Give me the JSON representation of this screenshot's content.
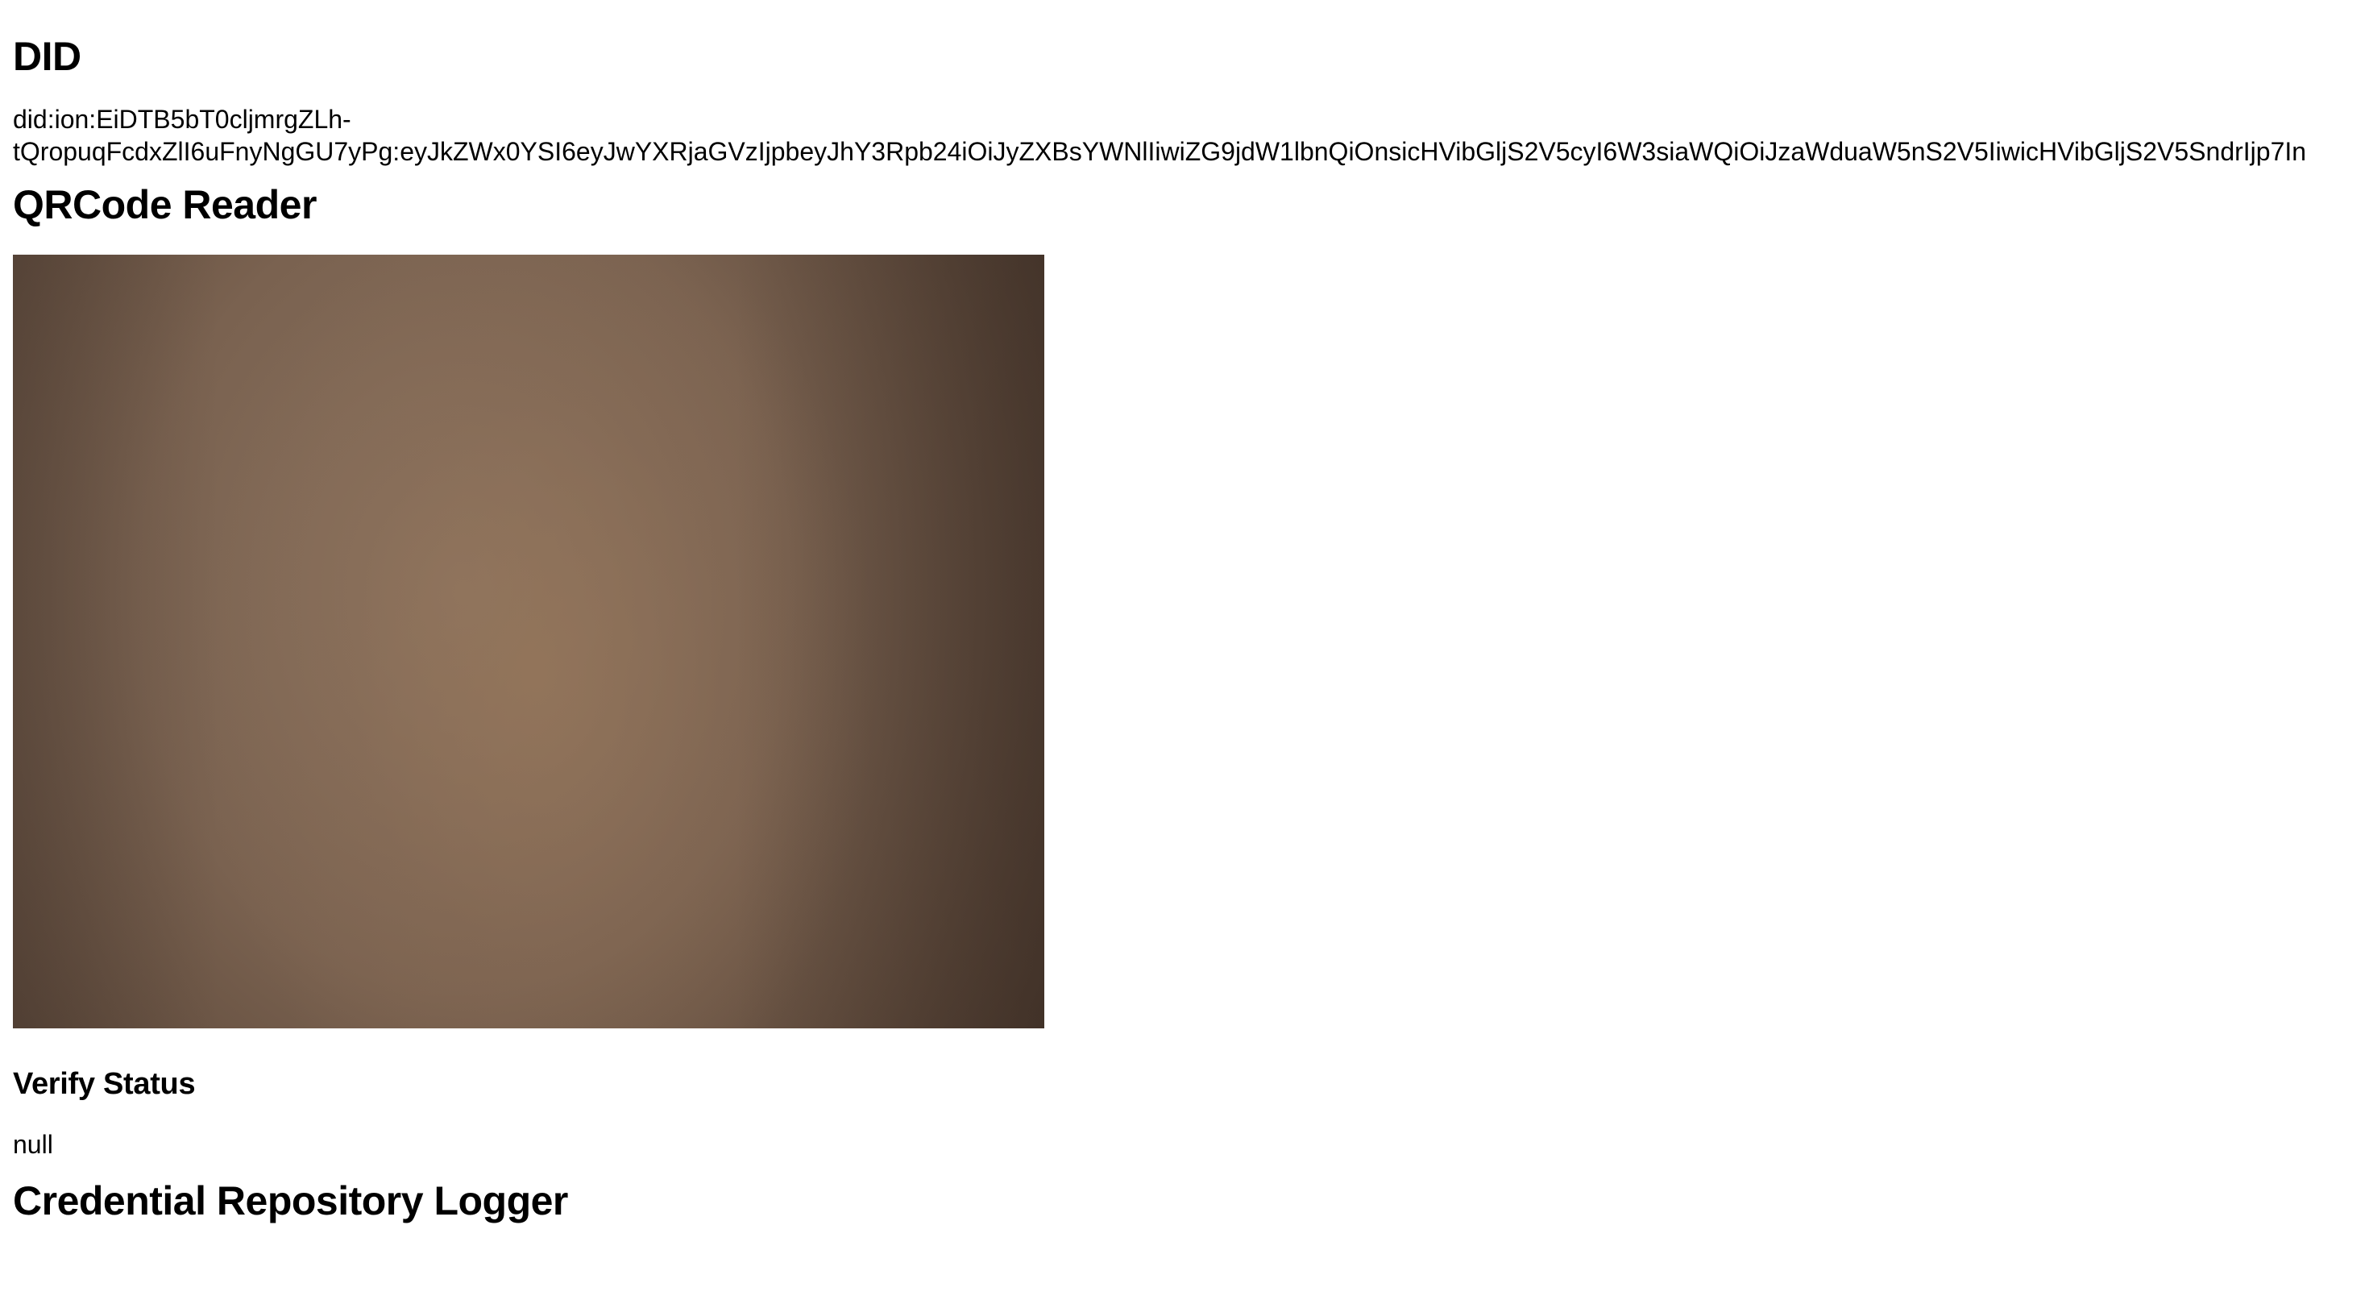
{
  "did_section": {
    "heading": "DID",
    "value_line1": "did:ion:EiDTB5bT0cljmrgZLh-",
    "value_line2": "tQropuqFcdxZlI6uFnyNgGU7yPg:eyJkZWx0YSI6eyJwYXRjaGVzIjpbeyJhY3Rpb24iOiJyZXBsYWNlIiwiZG9jdW1lbnQiOnsicHVibGljS2V5cyI6W3siaWQiOiJzaWduaW5nS2V5IiwicHVibGljS2V5SndrIjp7In"
  },
  "qr_section": {
    "heading": "QRCode Reader"
  },
  "verify_section": {
    "heading": "Verify Status",
    "value": "null"
  },
  "logger_section": {
    "heading": "Credential Repository Logger"
  }
}
